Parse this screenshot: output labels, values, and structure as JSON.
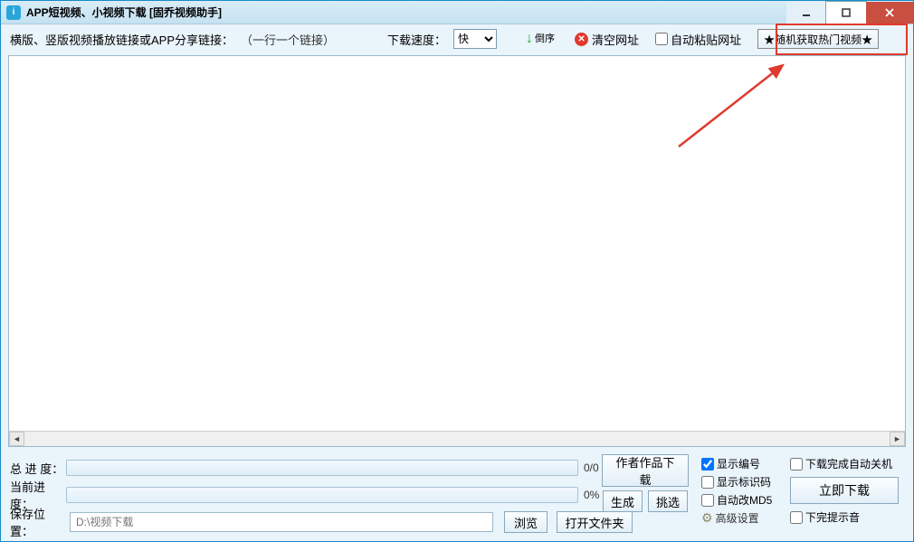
{
  "window": {
    "title": "APP短视频、小视频下载  [固乔视频助手]"
  },
  "toolbar": {
    "main_label": "横版、竖版视频播放链接或APP分享链接：",
    "hint": "（一行一个链接）",
    "speed_label": "下载速度：",
    "speed_value": "快",
    "reverse_label": "倒序",
    "clear_label": "清空网址",
    "auto_paste_label": "自动粘贴网址",
    "random_hot_label": "★随机获取热门视频★"
  },
  "textarea": {
    "value": ""
  },
  "progress": {
    "total_label": "总 进 度：",
    "total_text": "0/0",
    "current_label": "当前进度：",
    "current_text": "0%"
  },
  "save": {
    "label": "保存位置：",
    "path_placeholder": "D:\\视频下载",
    "browse": "浏览",
    "open_folder": "打开文件夹"
  },
  "mid": {
    "author_download": "作者作品下载",
    "generate": "生成",
    "pick": "挑选"
  },
  "options": {
    "show_index": "显示编号",
    "show_index_checked": true,
    "show_mark": "显示标识码",
    "auto_md5": "自动改MD5",
    "advanced": "高级设置"
  },
  "right": {
    "auto_shutdown": "下载完成自动关机",
    "download_now": "立即下载",
    "no_sound": "下完提示音"
  }
}
